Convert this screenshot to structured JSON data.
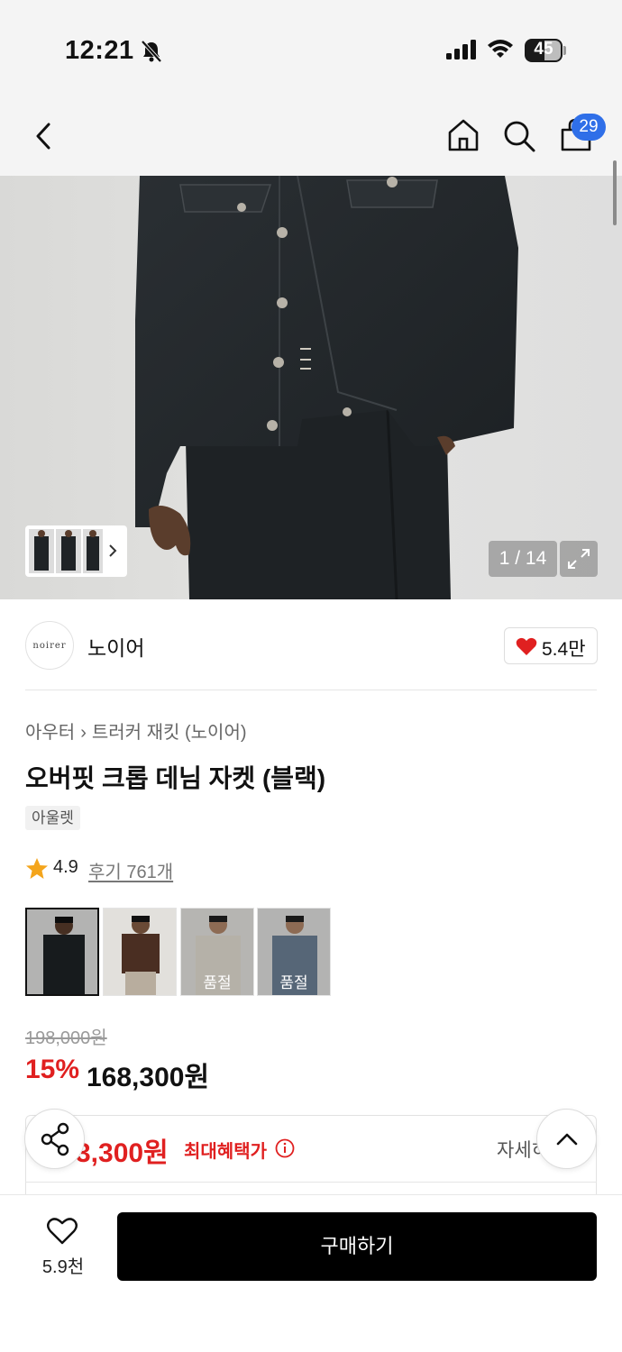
{
  "status_bar": {
    "time": "12:21",
    "battery": "45"
  },
  "nav": {
    "cart_count": "29",
    "icons": [
      "back-icon",
      "home-icon",
      "search-icon",
      "cart-icon"
    ]
  },
  "gallery": {
    "counter": "1 / 14"
  },
  "brand": {
    "logo_text": "noirer",
    "name": "노이어",
    "like_count": "5.4만"
  },
  "product": {
    "breadcrumb": [
      "아우터",
      "트러커 재킷 (노이어)"
    ],
    "title": "오버핏 크롭 데님 자켓 (블랙)",
    "tag": "아울렛",
    "rating": "4.9",
    "reviews": "후기 761개",
    "colors": [
      {
        "label": "",
        "sold_out": false
      },
      {
        "label": "",
        "sold_out": false
      },
      {
        "label": "품절",
        "sold_out": true
      },
      {
        "label": "품절",
        "sold_out": true
      }
    ],
    "original_price": "198,000원",
    "discount": "15%",
    "sale_price": "168,300원"
  },
  "benefit": {
    "amount": "3,300원",
    "label": "최대혜택가",
    "detail": "자세히"
  },
  "bottom": {
    "wish_count": "5.9천",
    "buy_label": "구매하기"
  },
  "colors": {
    "accent_red": "#e02020",
    "badge_blue": "#2f6fe8",
    "button_black": "#000000"
  }
}
